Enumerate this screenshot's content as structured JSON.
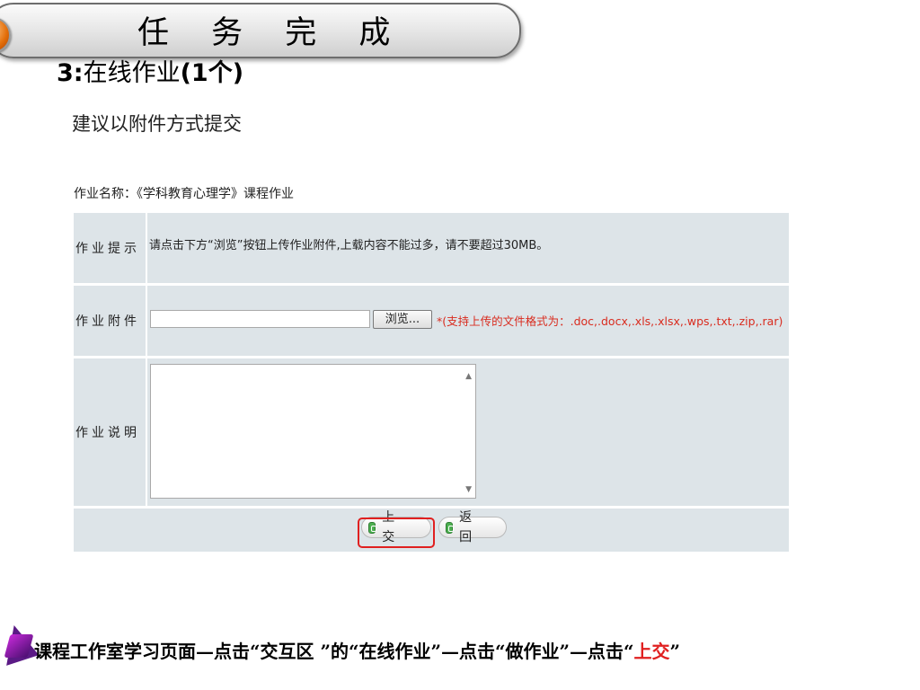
{
  "banner": {
    "title": "任 务 完 成"
  },
  "subtitle": {
    "prefix": "3:",
    "text": "在线作业",
    "suffix": "(1个)"
  },
  "suggestion": "建议以附件方式提交",
  "form": {
    "homework_name": "作业名称：《学科教育心理学》课程作业",
    "tip_label": "作业提示",
    "tip_text": "请点击下方“浏览”按钮上传作业附件,上载内容不能过多，请不要超过30MB。",
    "attachment_label": "作业附件",
    "browse_label": "浏览...",
    "formats_text": "*(支持上传的文件格式为：.doc,.docx,.xls,.xlsx,.wps,.txt,.zip,.rar)",
    "description_label": "作业说明",
    "submit_label": "上 交",
    "back_label": "返 回"
  },
  "footer": {
    "text": "课程工作室学习页面—点击“交互区 ”的“在线作业”—点击“做作业”—点击“",
    "highlight": "上交",
    "end": "”"
  },
  "colors": {
    "form_bg": "#dde4e8",
    "highlight_red": "#e02020",
    "formats_red": "#d92b1e"
  }
}
